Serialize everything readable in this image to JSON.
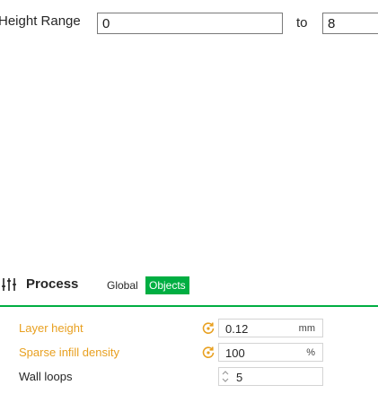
{
  "height_range": {
    "label": "Height Range",
    "from_value": "0",
    "to_label": "to",
    "to_value": "8"
  },
  "process": {
    "title": "Process",
    "icon": "sliders-icon",
    "tabs": [
      {
        "label": "Global",
        "active": false
      },
      {
        "label": "Objects",
        "active": true
      }
    ]
  },
  "settings": [
    {
      "label": "Layer height",
      "value": "0.12",
      "unit": "mm",
      "modified": true
    },
    {
      "label": "Sparse infill density",
      "value": "100",
      "unit": "%",
      "modified": true
    },
    {
      "label": "Wall loops",
      "value": "5",
      "unit": "",
      "modified": false
    }
  ],
  "colors": {
    "accent": "#00ae42",
    "modified_label": "#e8a020"
  }
}
